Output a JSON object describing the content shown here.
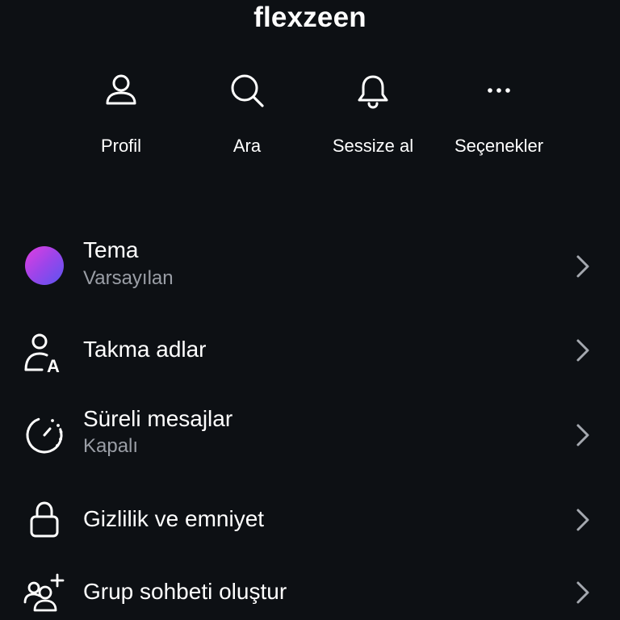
{
  "header": {
    "title": "flexzeen"
  },
  "actions": [
    {
      "label": "Profil",
      "icon": "person-icon"
    },
    {
      "label": "Ara",
      "icon": "search-icon"
    },
    {
      "label": "Sessize al",
      "icon": "bell-icon"
    },
    {
      "label": "Seçenekler",
      "icon": "more-dots-icon"
    }
  ],
  "settings": {
    "theme": {
      "title": "Tema",
      "subtitle": "Varsayılan",
      "icon": "theme-gradient-dot"
    },
    "nicknames": {
      "title": "Takma adlar",
      "icon": "person-nickname-icon"
    },
    "disappearing": {
      "title": "Süreli mesajlar",
      "subtitle": "Kapalı",
      "icon": "timer-icon"
    },
    "privacy": {
      "title": "Gizlilik ve emniyet",
      "icon": "lock-icon"
    },
    "group": {
      "title": "Grup sohbeti oluştur",
      "icon": "add-group-icon"
    }
  },
  "colors": {
    "background": "#0d1014",
    "text": "#ffffff",
    "subtext": "#9a9ea6",
    "chevron": "#a4a8af",
    "theme_gradient": [
      "#e13ee0",
      "#9b45ea",
      "#5a55f0"
    ]
  }
}
